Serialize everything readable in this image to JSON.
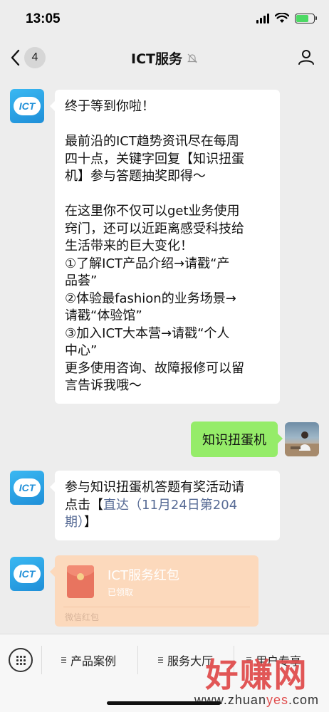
{
  "status_bar": {
    "time": "13:05",
    "battery_state": "charging"
  },
  "nav": {
    "unread_count": "4",
    "title": "ICT服务",
    "muted_icon": "bell-off-icon",
    "profile_icon": "person-icon"
  },
  "account_avatar": {
    "text": "ICT"
  },
  "messages": {
    "welcome": {
      "greeting": "终于等到你啦！",
      "p1": [
        "最前沿的ICT趋势资讯尽在每周",
        "四十点，关键字回复【知识扭蛋",
        "机】参与答题抽奖即得～"
      ],
      "p2": [
        "在这里你不仅可以get业务使用",
        "窍门，还可以近距离感受科技给",
        "生活带来的巨大变化！",
        "①了解ICT产品介绍→请戳“产",
        "品荟”",
        "②体验最fashion的业务场景→",
        "请戳“体验馆”",
        "③加入ICT大本营→请戳“个人",
        "中心”",
        "更多使用咨询、故障报修可以留",
        "言告诉我哦～"
      ]
    },
    "user_reply": "知识扭蛋机",
    "activity": {
      "line1": "参与知识扭蛋机答题有奖活动请",
      "line2_prefix": "点击【",
      "line2_link": "直达（11月24日第204",
      "line3_link": "期）",
      "line3_suffix": "】"
    },
    "red_packet": {
      "title": "ICT服务红包",
      "status": "已领取",
      "label": "微信红包"
    }
  },
  "menu": {
    "keyboard_icon": "keyboard-icon",
    "items": [
      "产品案例",
      "服务大厅",
      "用户专享"
    ]
  },
  "watermark": {
    "main": "好赚网",
    "sub_prefix": "www.zhuan",
    "sub_highlight": "yes",
    "sub_suffix": ".com"
  },
  "colors": {
    "outgoing_bubble": "#95ec69",
    "link": "#576b95",
    "red_packet": "#fcd9bc",
    "watermark": "#e04e4e"
  }
}
